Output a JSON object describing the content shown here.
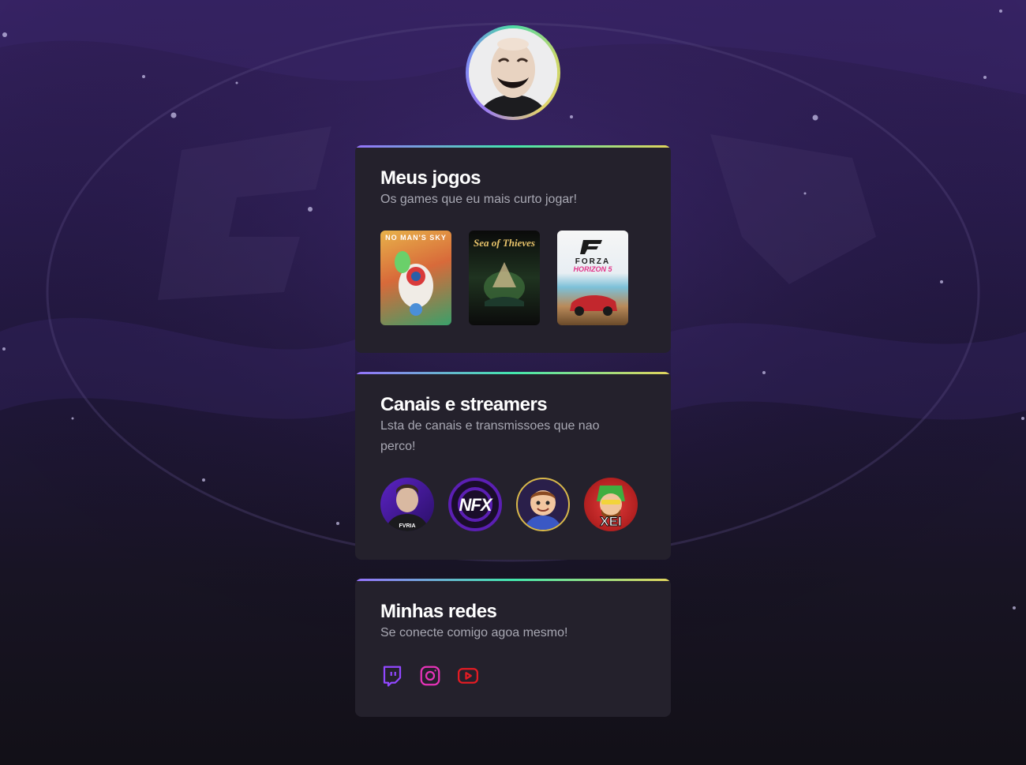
{
  "profile": {
    "avatar_icon": "masked-face-avatar"
  },
  "cards": {
    "games": {
      "title": "Meus jogos",
      "subtitle": "Os games que eu mais curto jogar!",
      "items": [
        {
          "label": "NO MAN'S SKY",
          "icon": "no-mans-sky-cover"
        },
        {
          "label": "Sea of Thieves",
          "icon": "sea-of-thieves-cover"
        },
        {
          "label": "FORZA",
          "label2": "HORIZON 5",
          "icon": "forza-horizon-5-cover"
        }
      ]
    },
    "streamers": {
      "title": "Canais e streamers",
      "subtitle": "Lsta de canais e transmissoes que nao perco!",
      "items": [
        {
          "icon": "streamer-avatar-1",
          "label": "FVRIA"
        },
        {
          "icon": "nfx-channel-logo",
          "label": "NFX"
        },
        {
          "icon": "cartoon-streamer-avatar"
        },
        {
          "icon": "xei-channel-logo",
          "label": "XEI"
        }
      ]
    },
    "socials": {
      "title": "Minhas redes",
      "subtitle": "Se conecte comigo agoa mesmo!",
      "items": [
        {
          "icon": "twitch-icon",
          "color": "#9147ff"
        },
        {
          "icon": "instagram-icon",
          "color": "#e633b8"
        },
        {
          "icon": "youtube-icon",
          "color": "#e41b23"
        }
      ]
    }
  },
  "colors": {
    "card_bg": "#24212c",
    "accent_gradient": [
      "#9572fc",
      "#43e7ad",
      "#e2d45c"
    ],
    "text_primary": "#ffffff",
    "text_secondary": "#a8a8b3"
  }
}
